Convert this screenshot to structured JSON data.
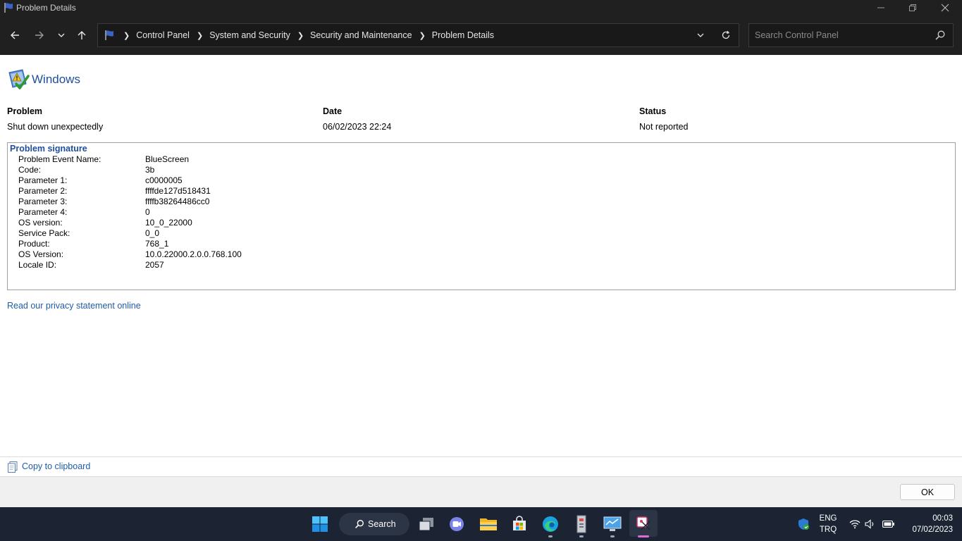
{
  "window": {
    "title": "Problem Details"
  },
  "address_bar": {
    "breadcrumbs": [
      "Control Panel",
      "System and Security",
      "Security and Maintenance",
      "Problem Details"
    ]
  },
  "search": {
    "placeholder": "Search Control Panel"
  },
  "main": {
    "heading": "Windows",
    "columns": [
      {
        "label": "Problem",
        "value": "Shut down unexpectedly"
      },
      {
        "label": "Date",
        "value": "06/02/2023 22:24"
      },
      {
        "label": "Status",
        "value": "Not reported"
      }
    ],
    "signature": {
      "title": "Problem signature",
      "rows": [
        {
          "key": "Problem Event Name:",
          "value": "BlueScreen"
        },
        {
          "key": "Code:",
          "value": "3b"
        },
        {
          "key": "Parameter 1:",
          "value": "c0000005"
        },
        {
          "key": "Parameter 2:",
          "value": "ffffde127d518431"
        },
        {
          "key": "Parameter 3:",
          "value": "ffffb38264486cc0"
        },
        {
          "key": "Parameter 4:",
          "value": "0"
        },
        {
          "key": "OS version:",
          "value": "10_0_22000"
        },
        {
          "key": "Service Pack:",
          "value": "0_0"
        },
        {
          "key": "Product:",
          "value": "768_1"
        },
        {
          "key": "OS Version:",
          "value": "10.0.22000.2.0.0.768.100"
        },
        {
          "key": "Locale ID:",
          "value": "2057"
        }
      ]
    },
    "privacy_link": "Read our privacy statement online"
  },
  "clipboard": {
    "label": "Copy to clipboard"
  },
  "footer": {
    "ok_label": "OK"
  },
  "taskbar": {
    "search_label": "Search",
    "language": "ENG",
    "keyboard": "TRQ",
    "time": "00:03",
    "date": "07/02/2023"
  },
  "colors": {
    "link": "#1e5ca8",
    "heading": "#1e4e9c",
    "titlebar": "#202020",
    "taskbar": "#1c2433"
  }
}
